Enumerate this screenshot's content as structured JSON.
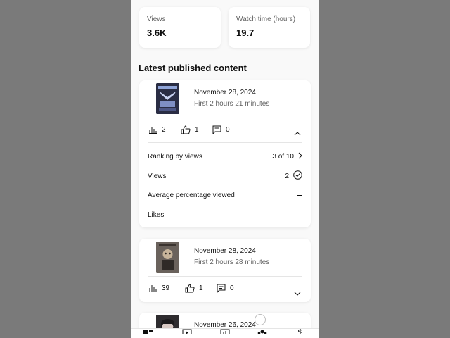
{
  "stats": [
    {
      "label": "Views",
      "value": "3.6K"
    },
    {
      "label": "Watch time (hours)",
      "value": "19.7"
    }
  ],
  "section_title": "Latest published content",
  "videos": [
    {
      "date": "November 28, 2024",
      "duration": "First 2 hours 21 minutes",
      "views": "2",
      "likes": "1",
      "comments": "0",
      "expanded": true
    },
    {
      "date": "November 28, 2024",
      "duration": "First 2 hours 28 minutes",
      "views": "39",
      "likes": "1",
      "comments": "0",
      "expanded": false
    },
    {
      "date": "November 26, 2024"
    }
  ],
  "details": {
    "ranking_label": "Ranking by views",
    "ranking_value": "3 of 10",
    "views_label": "Views",
    "views_value": "2",
    "avg_label": "Average percentage viewed",
    "likes_label": "Likes"
  },
  "icons": {
    "views": "bar-chart-icon",
    "likes": "thumb-up-icon",
    "comments": "comment-icon",
    "expand": "chevron-icon",
    "check": "check-circle-icon"
  }
}
